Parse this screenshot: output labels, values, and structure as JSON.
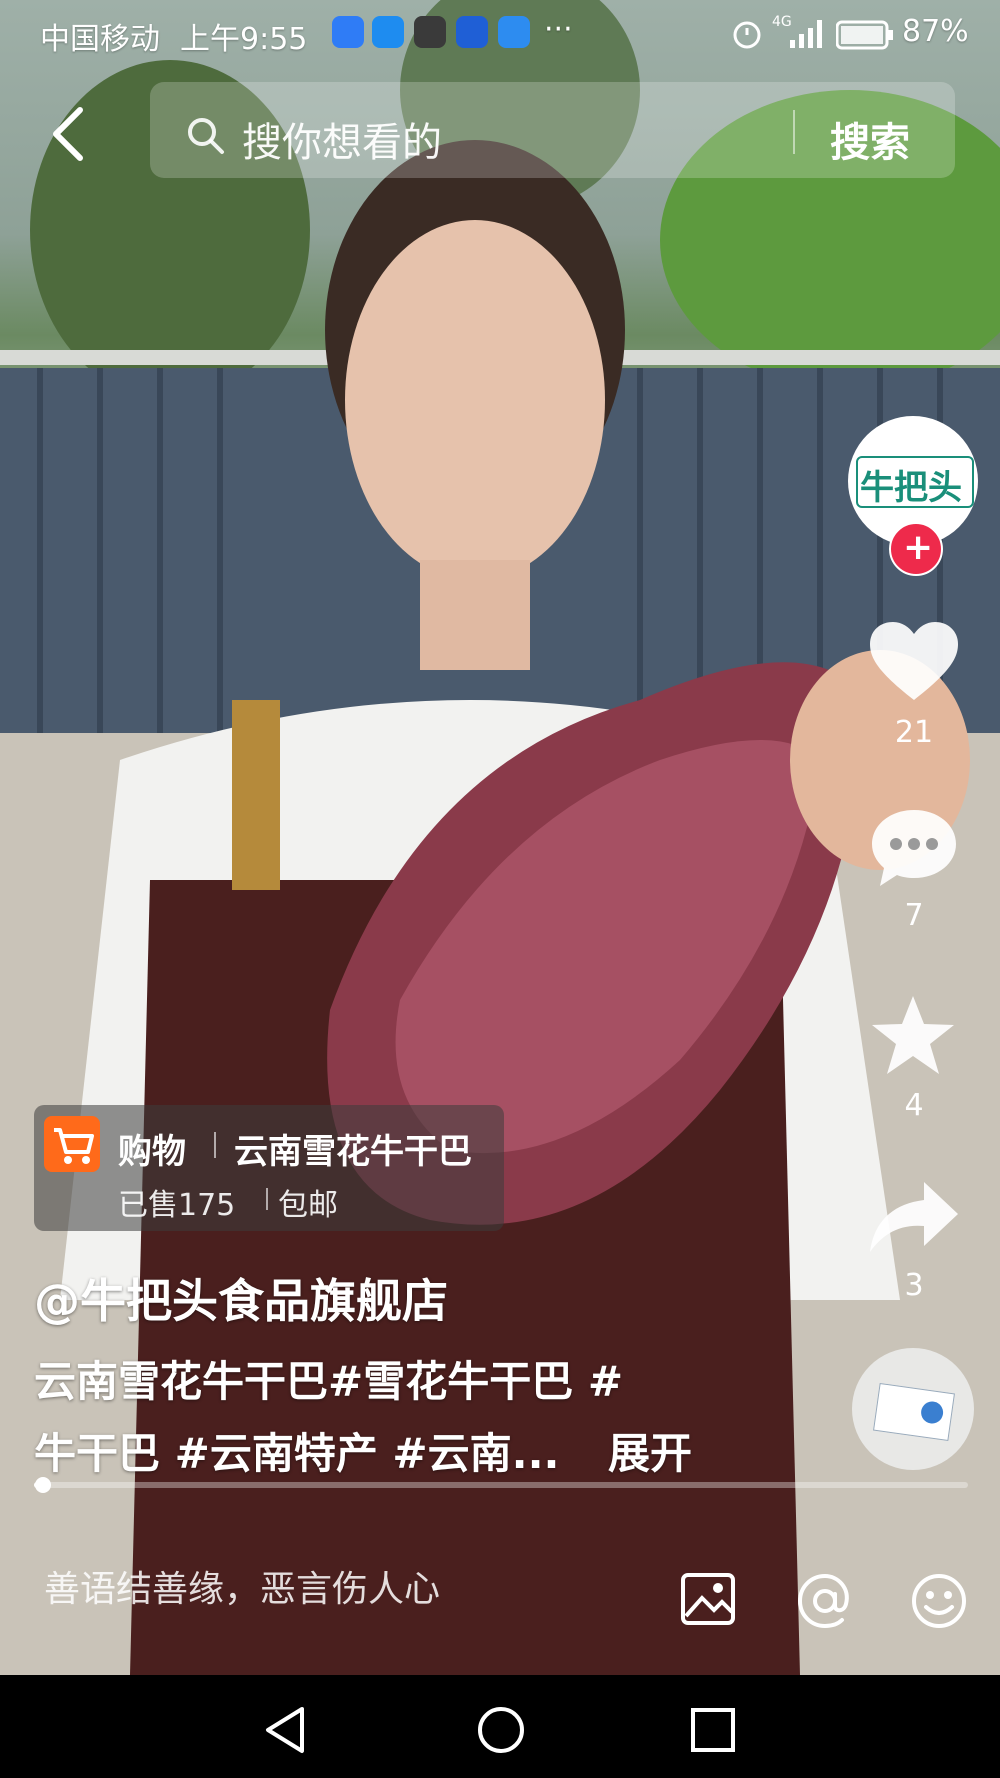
{
  "status_bar": {
    "carrier": "中国移动",
    "time": "上午9:55",
    "overflow": "···",
    "network": "4G",
    "battery": "87%"
  },
  "search": {
    "placeholder": "搜你想看的",
    "button_label": "搜索"
  },
  "author": {
    "avatar_text": "牛把头",
    "likes": "21",
    "comments": "7",
    "favorites": "4",
    "shares": "3"
  },
  "shop": {
    "tag": "购物",
    "product": "云南雪花牛干巴",
    "sold": "已售175",
    "shipping": "包邮"
  },
  "caption": {
    "username": "@牛把头食品旗舰店",
    "line1": "云南雪花牛干巴#雪花牛干巴 #",
    "line2": "牛干巴 #云南特产 #云南...",
    "expand": "展开"
  },
  "playback": {
    "progress": 0.01
  },
  "comment_bar": {
    "placeholder": "善语结善缘，恶言伤人心"
  },
  "colors": {
    "follow": "#ee2a4b",
    "cart": "#ff6a1a",
    "avatar_text": "#1a8f7a"
  }
}
